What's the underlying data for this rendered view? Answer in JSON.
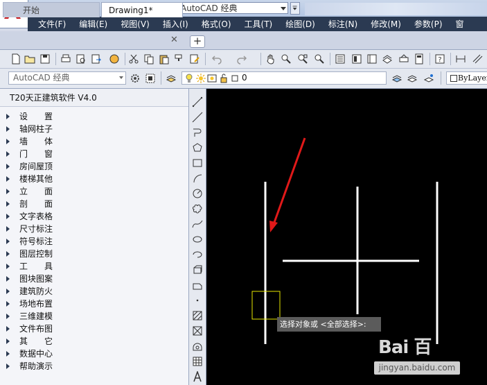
{
  "title_bar": {
    "workspace": "AutoCAD 经典"
  },
  "menu": {
    "items": [
      "文件(F)",
      "编辑(E)",
      "视图(V)",
      "插入(I)",
      "格式(O)",
      "工具(T)",
      "绘图(D)",
      "标注(N)",
      "修改(M)",
      "参数(P)",
      "窗"
    ]
  },
  "tabs": {
    "start": "开始",
    "drawing": "Drawing1*",
    "close": "✕",
    "add": "+"
  },
  "toolbar2": {
    "workspace": "AutoCAD 经典",
    "layer": "0",
    "linetype": "ByLayer"
  },
  "t20_panel": {
    "title": "T20天正建筑软件 V4.0",
    "items": [
      "设　　置",
      "轴网柱子",
      "墙　　体",
      "门　　窗",
      "房间屋顶",
      "楼梯其他",
      "立　　面",
      "剖　　面",
      "文字表格",
      "尺寸标注",
      "符号标注",
      "图层控制",
      "工　　具",
      "图块图案",
      "建筑防火",
      "场地布置",
      "三维建模",
      "文件布图",
      "其　　它",
      "数据中心",
      "帮助演示"
    ]
  },
  "canvas": {
    "prompt": "选择对象或 <全部选择>:",
    "arrow_color": "#e01919",
    "selection_box_color": "#e8e800"
  },
  "watermark": {
    "logo": "Bai 百",
    "url": "jingyan.baidu.com"
  },
  "colors": {
    "menu_bg": "#2b3a52",
    "canvas_bg": "#000000",
    "logo_red": "#c8161d"
  }
}
